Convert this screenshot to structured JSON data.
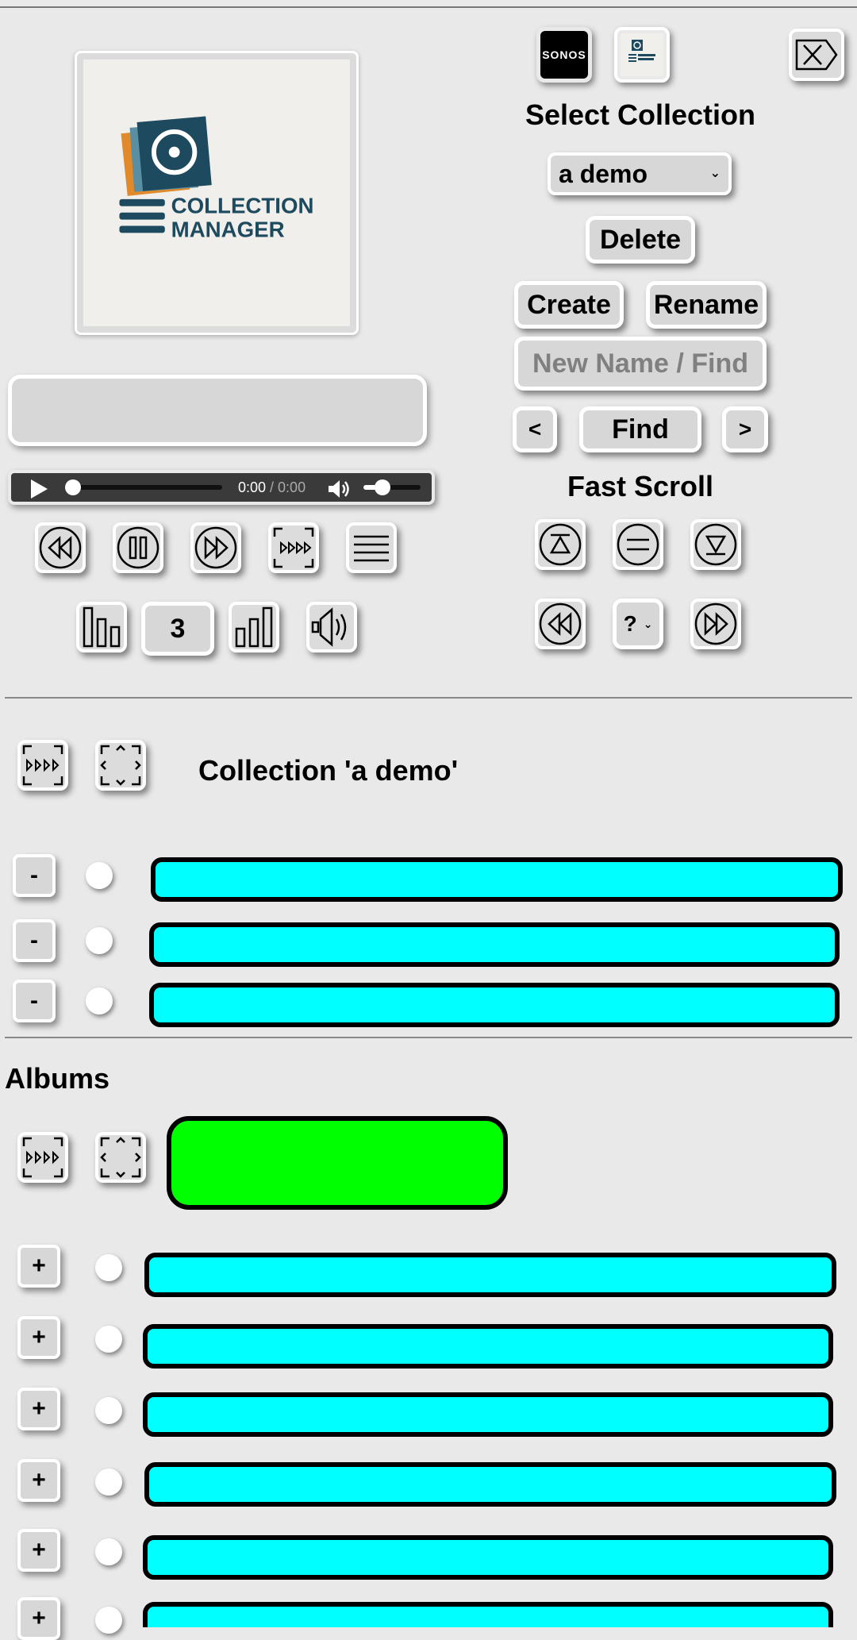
{
  "header": {
    "select_heading": "Select Collection",
    "selected_collection": "a demo",
    "delete_label": "Delete",
    "create_label": "Create",
    "rename_label": "Rename",
    "name_find_placeholder": "New Name / Find",
    "prev_label": "<",
    "find_label": "Find",
    "next_label": ">",
    "fast_scroll_heading": "Fast Scroll",
    "fast_scroll_jump_value": "?"
  },
  "logos": {
    "sonos_text": "SONOS",
    "app_logo_line1": "COLLECTION",
    "app_logo_line2": "MANAGER"
  },
  "player": {
    "current_time": "0:00",
    "separator_duration": " / 0:00",
    "progress": 0,
    "volume": 0.35
  },
  "controls": {
    "volume_step": "3"
  },
  "collection": {
    "title": "Collection 'a demo'",
    "remove_label": "-",
    "rows": 3
  },
  "albums": {
    "heading": "Albums",
    "add_label": "+",
    "rows": 6
  },
  "colors": {
    "background": "#e9e9e9",
    "item_bar": "#00ffff",
    "album_art_placeholder": "#00ff00",
    "logo_dark": "#1d4a5e",
    "logo_orange": "#e08a2c"
  }
}
